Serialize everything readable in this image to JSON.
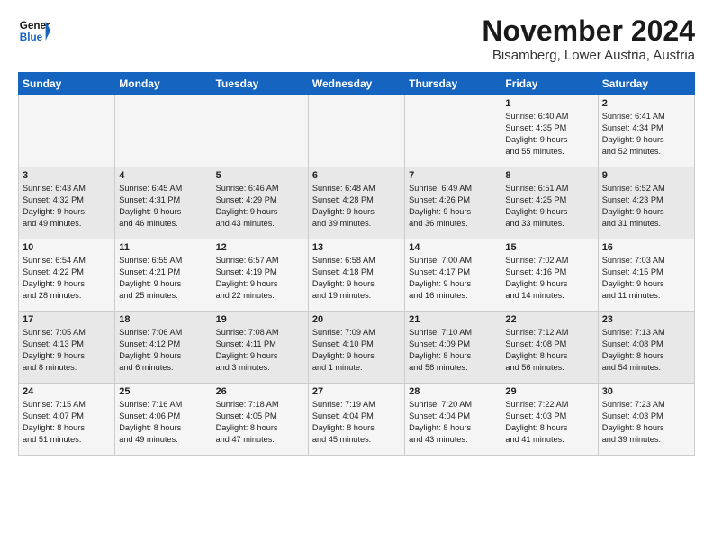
{
  "header": {
    "logo_line1": "General",
    "logo_line2": "Blue",
    "month": "November 2024",
    "location": "Bisamberg, Lower Austria, Austria"
  },
  "days_of_week": [
    "Sunday",
    "Monday",
    "Tuesday",
    "Wednesday",
    "Thursday",
    "Friday",
    "Saturday"
  ],
  "weeks": [
    [
      {
        "day": "",
        "info": ""
      },
      {
        "day": "",
        "info": ""
      },
      {
        "day": "",
        "info": ""
      },
      {
        "day": "",
        "info": ""
      },
      {
        "day": "",
        "info": ""
      },
      {
        "day": "1",
        "info": "Sunrise: 6:40 AM\nSunset: 4:35 PM\nDaylight: 9 hours\nand 55 minutes."
      },
      {
        "day": "2",
        "info": "Sunrise: 6:41 AM\nSunset: 4:34 PM\nDaylight: 9 hours\nand 52 minutes."
      }
    ],
    [
      {
        "day": "3",
        "info": "Sunrise: 6:43 AM\nSunset: 4:32 PM\nDaylight: 9 hours\nand 49 minutes."
      },
      {
        "day": "4",
        "info": "Sunrise: 6:45 AM\nSunset: 4:31 PM\nDaylight: 9 hours\nand 46 minutes."
      },
      {
        "day": "5",
        "info": "Sunrise: 6:46 AM\nSunset: 4:29 PM\nDaylight: 9 hours\nand 43 minutes."
      },
      {
        "day": "6",
        "info": "Sunrise: 6:48 AM\nSunset: 4:28 PM\nDaylight: 9 hours\nand 39 minutes."
      },
      {
        "day": "7",
        "info": "Sunrise: 6:49 AM\nSunset: 4:26 PM\nDaylight: 9 hours\nand 36 minutes."
      },
      {
        "day": "8",
        "info": "Sunrise: 6:51 AM\nSunset: 4:25 PM\nDaylight: 9 hours\nand 33 minutes."
      },
      {
        "day": "9",
        "info": "Sunrise: 6:52 AM\nSunset: 4:23 PM\nDaylight: 9 hours\nand 31 minutes."
      }
    ],
    [
      {
        "day": "10",
        "info": "Sunrise: 6:54 AM\nSunset: 4:22 PM\nDaylight: 9 hours\nand 28 minutes."
      },
      {
        "day": "11",
        "info": "Sunrise: 6:55 AM\nSunset: 4:21 PM\nDaylight: 9 hours\nand 25 minutes."
      },
      {
        "day": "12",
        "info": "Sunrise: 6:57 AM\nSunset: 4:19 PM\nDaylight: 9 hours\nand 22 minutes."
      },
      {
        "day": "13",
        "info": "Sunrise: 6:58 AM\nSunset: 4:18 PM\nDaylight: 9 hours\nand 19 minutes."
      },
      {
        "day": "14",
        "info": "Sunrise: 7:00 AM\nSunset: 4:17 PM\nDaylight: 9 hours\nand 16 minutes."
      },
      {
        "day": "15",
        "info": "Sunrise: 7:02 AM\nSunset: 4:16 PM\nDaylight: 9 hours\nand 14 minutes."
      },
      {
        "day": "16",
        "info": "Sunrise: 7:03 AM\nSunset: 4:15 PM\nDaylight: 9 hours\nand 11 minutes."
      }
    ],
    [
      {
        "day": "17",
        "info": "Sunrise: 7:05 AM\nSunset: 4:13 PM\nDaylight: 9 hours\nand 8 minutes."
      },
      {
        "day": "18",
        "info": "Sunrise: 7:06 AM\nSunset: 4:12 PM\nDaylight: 9 hours\nand 6 minutes."
      },
      {
        "day": "19",
        "info": "Sunrise: 7:08 AM\nSunset: 4:11 PM\nDaylight: 9 hours\nand 3 minutes."
      },
      {
        "day": "20",
        "info": "Sunrise: 7:09 AM\nSunset: 4:10 PM\nDaylight: 9 hours\nand 1 minute."
      },
      {
        "day": "21",
        "info": "Sunrise: 7:10 AM\nSunset: 4:09 PM\nDaylight: 8 hours\nand 58 minutes."
      },
      {
        "day": "22",
        "info": "Sunrise: 7:12 AM\nSunset: 4:08 PM\nDaylight: 8 hours\nand 56 minutes."
      },
      {
        "day": "23",
        "info": "Sunrise: 7:13 AM\nSunset: 4:08 PM\nDaylight: 8 hours\nand 54 minutes."
      }
    ],
    [
      {
        "day": "24",
        "info": "Sunrise: 7:15 AM\nSunset: 4:07 PM\nDaylight: 8 hours\nand 51 minutes."
      },
      {
        "day": "25",
        "info": "Sunrise: 7:16 AM\nSunset: 4:06 PM\nDaylight: 8 hours\nand 49 minutes."
      },
      {
        "day": "26",
        "info": "Sunrise: 7:18 AM\nSunset: 4:05 PM\nDaylight: 8 hours\nand 47 minutes."
      },
      {
        "day": "27",
        "info": "Sunrise: 7:19 AM\nSunset: 4:04 PM\nDaylight: 8 hours\nand 45 minutes."
      },
      {
        "day": "28",
        "info": "Sunrise: 7:20 AM\nSunset: 4:04 PM\nDaylight: 8 hours\nand 43 minutes."
      },
      {
        "day": "29",
        "info": "Sunrise: 7:22 AM\nSunset: 4:03 PM\nDaylight: 8 hours\nand 41 minutes."
      },
      {
        "day": "30",
        "info": "Sunrise: 7:23 AM\nSunset: 4:03 PM\nDaylight: 8 hours\nand 39 minutes."
      }
    ]
  ]
}
